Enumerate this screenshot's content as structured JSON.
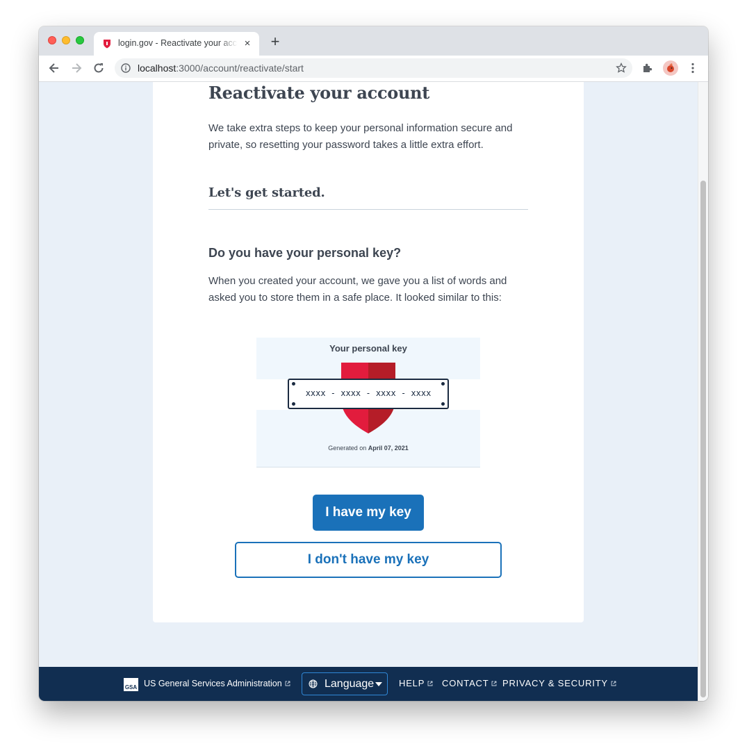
{
  "browser": {
    "tab_title": "login.gov - Reactivate your account",
    "tab_close": "×",
    "new_tab": "+",
    "url_host": "localhost",
    "url_rest": ":3000/account/reactivate/start"
  },
  "page": {
    "title": "Reactivate your account",
    "intro": "We take extra steps to keep your personal information secure and private, so resetting your password takes a little extra effort.",
    "subtitle": "Let's get started.",
    "question": "Do you have your personal key?",
    "explanation": "When you created your account, we gave you a list of words and asked you to store them in a safe place. It looked similar to this:"
  },
  "key_image": {
    "heading": "Your personal key",
    "code": "xxxx - xxxx - xxxx - xxxx",
    "generated_prefix": "Generated on",
    "generated_date": "April 07, 2021"
  },
  "actions": {
    "primary_label": "I have my key",
    "secondary_label": "I don't have my key"
  },
  "footer": {
    "gsa_logo": "GSA",
    "agency": "US General Services Administration",
    "language_label": "Language",
    "links": [
      "HELP",
      "CONTACT",
      "PRIVACY & SECURITY"
    ]
  },
  "colors": {
    "primary": "#1a71b9",
    "footer_bg": "#112e51",
    "page_bg": "#e9f0f8",
    "shield_left": "#e21c3d",
    "shield_right": "#b51d28"
  }
}
